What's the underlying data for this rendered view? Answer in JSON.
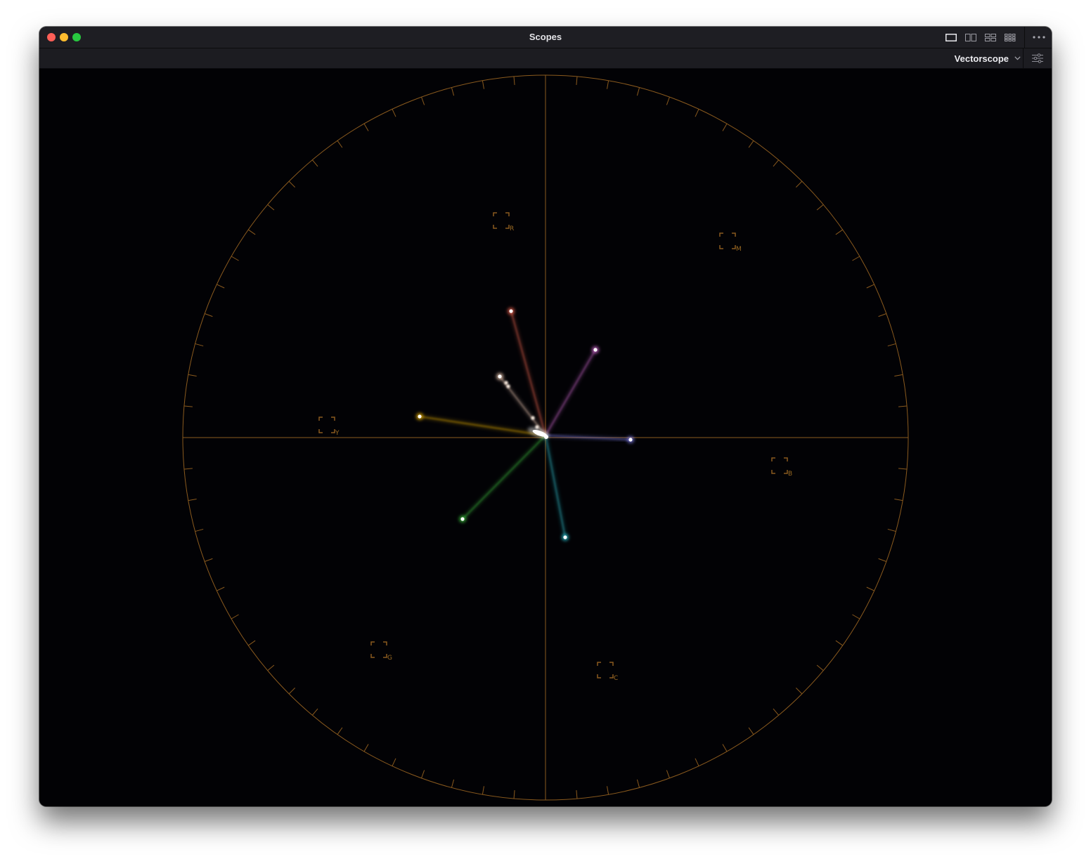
{
  "window": {
    "title": "Scopes"
  },
  "toolbar": {
    "layout_buttons": [
      "single-layout-icon",
      "dual-layout-icon",
      "quad-layout-icon",
      "grid-layout-icon"
    ],
    "more_icon": "ellipsis-icon",
    "scope_select": "Vectorscope",
    "settings_icon": "sliders-icon"
  },
  "colors": {
    "graticule": "#8a5a1e",
    "window_bg": "#020204",
    "titlebar_bg": "#1e1e23"
  },
  "vectorscope": {
    "targets": [
      {
        "label": "R"
      },
      {
        "label": "M"
      },
      {
        "label": "Y"
      },
      {
        "label": "B"
      },
      {
        "label": "G"
      },
      {
        "label": "C"
      }
    ],
    "traces": [
      {
        "name": "red",
        "color": "#ff6a55"
      },
      {
        "name": "magenta",
        "color": "#e070e0"
      },
      {
        "name": "skin",
        "color": "#ffd8c0"
      },
      {
        "name": "yellow",
        "color": "#ffc000"
      },
      {
        "name": "blue",
        "color": "#8a88ff"
      },
      {
        "name": "green",
        "color": "#40d040"
      },
      {
        "name": "cyan",
        "color": "#30d0e0"
      }
    ]
  }
}
